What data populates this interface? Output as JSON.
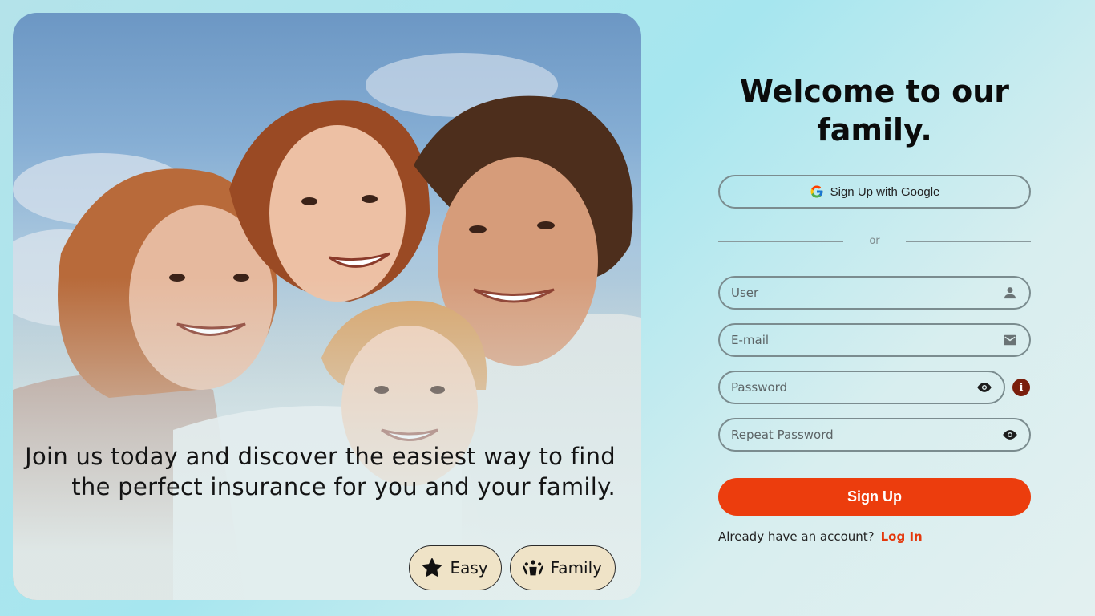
{
  "hero": {
    "caption": "Join us today and discover the easiest way to find the perfect insurance for you and your family.",
    "chips": [
      {
        "label": "Easy",
        "icon": "star-icon"
      },
      {
        "label": "Family",
        "icon": "family-icon"
      }
    ]
  },
  "form": {
    "title": "Welcome to our family.",
    "google_label": "Sign Up with Google",
    "divider_text": "or",
    "fields": {
      "user": {
        "placeholder": "User",
        "value": "",
        "icon": "user-icon"
      },
      "email": {
        "placeholder": "E-mail",
        "value": "",
        "icon": "mail-icon"
      },
      "password": {
        "placeholder": "Password",
        "value": "",
        "icon": "eye-icon"
      },
      "repeat_password": {
        "placeholder": "Repeat Password",
        "value": "",
        "icon": "eye-icon"
      }
    },
    "info_badge": "i",
    "submit_label": "Sign Up",
    "login_prompt": "Already have an account?",
    "login_link": "Log In"
  },
  "colors": {
    "accent": "#ec3d0d",
    "link": "#e4380c",
    "chip_bg": "#efe3c7",
    "field_border": "#7b8c8f",
    "info_badge": "#7a1e0c"
  }
}
